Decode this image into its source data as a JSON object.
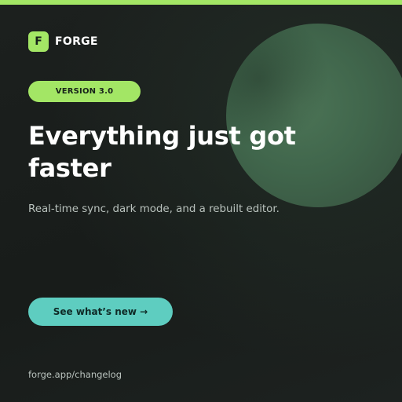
{
  "brand": {
    "logo_letter": "F",
    "name": "FORGE"
  },
  "badge": {
    "label": "VERSION 3.0"
  },
  "hero": {
    "headline": "Everything just got faster",
    "subtext": "Real-time sync, dark mode, and a rebuilt editor."
  },
  "cta": {
    "label": "See what’s new →"
  },
  "footer": {
    "url": "forge.app/changelog"
  },
  "colors": {
    "accent_green": "#a3e665",
    "cta_teal": "#5ecdc0",
    "background": "#1a1e1c",
    "circle": "#466f52"
  }
}
